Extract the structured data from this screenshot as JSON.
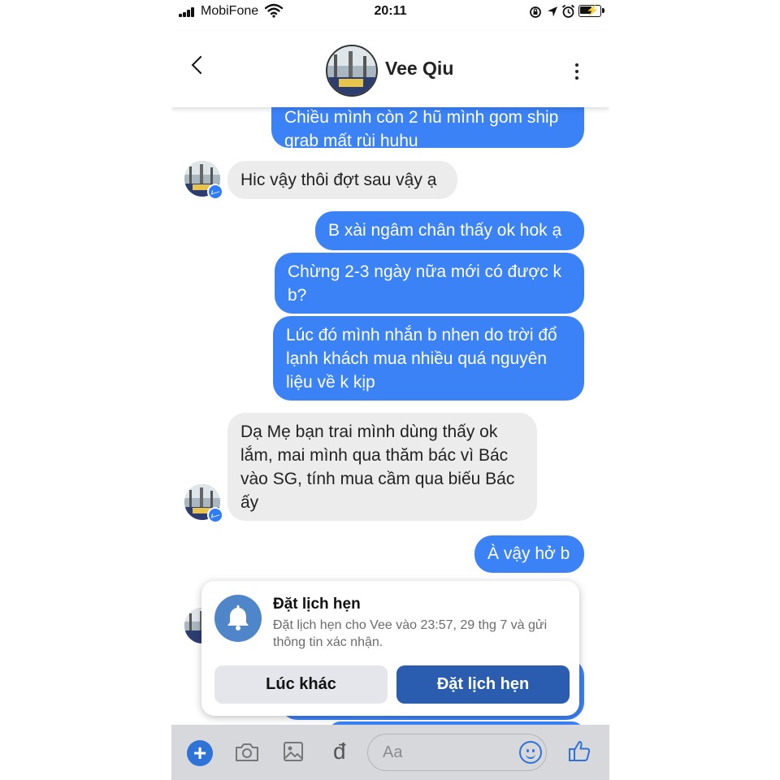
{
  "status_bar": {
    "carrier": "MobiFone",
    "time": "20:11"
  },
  "header": {
    "back_label": "back",
    "contact_name": "Vee Qiu"
  },
  "messages": [
    {
      "sender": "me",
      "text": "Chiều mình còn 2 hũ mình gom ship grab mất rùi huhu"
    },
    {
      "sender": "them",
      "text": "Hic vậy thôi đợt sau vậy ạ"
    },
    {
      "sender": "me",
      "text": "B xài ngâm chân thấy ok hok ạ"
    },
    {
      "sender": "me",
      "text": "Chừng 2-3 ngày nữa mới có được k b?"
    },
    {
      "sender": "me",
      "text": "Lúc đó mình nhắn b nhen do trời đổ lạnh khách mua nhiều quá nguyên liệu về k kịp"
    },
    {
      "sender": "them",
      "text": "Dạ Mẹ bạn trai mình dùng thấy ok lắm, mai mình qua thăm bác vì Bác vào SG, tính mua cầm qua biếu Bác ấy"
    },
    {
      "sender": "me",
      "text": "À vậy hở b"
    }
  ],
  "reminder": {
    "title": "Đặt lịch hẹn",
    "body": "Đặt lịch hẹn cho Vee vào 23:57, 29 thg 7 và gửi thông tin xác nhận.",
    "later_label": "Lúc khác",
    "book_label": "Đặt lịch hẹn"
  },
  "composer": {
    "placeholder": "Aa",
    "currency_label": "đ"
  },
  "colors": {
    "accent": "#3b82f6",
    "dialog_button": "#2a5db0",
    "bell_circle": "#4f86c9",
    "composer_bg": "#d6d8dc"
  },
  "icons": [
    "signal-icon",
    "wifi-icon",
    "rotation-lock-icon",
    "location-icon",
    "alarm-icon",
    "battery-icon",
    "chevron-left-icon",
    "more-vertical-icon",
    "messenger-badge-icon",
    "bell-icon",
    "plus-icon",
    "camera-icon",
    "image-icon",
    "smile-icon",
    "thumbs-up-icon"
  ]
}
